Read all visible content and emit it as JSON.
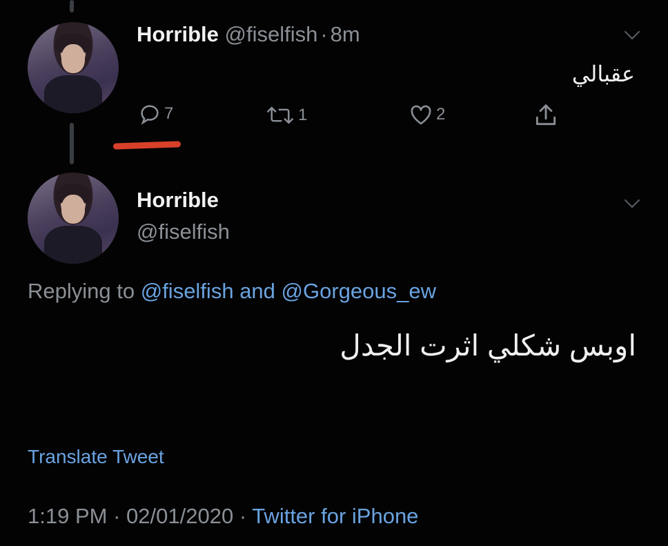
{
  "tweet1": {
    "name": "Horrible",
    "handle": "@fiselfish",
    "separator": "·",
    "time": "8m",
    "text": "عقبالي",
    "actions": {
      "reply_count": "7",
      "retweet_count": "1",
      "like_count": "2"
    }
  },
  "tweet2": {
    "name": "Horrible",
    "handle": "@fiselfish",
    "replying_prefix": "Replying to",
    "replying_user1": "@fiselfish",
    "replying_and": "and",
    "replying_user2": "@Gorgeous_ew",
    "text": "اوبس شكلي اثرت الجدل",
    "translate": "Translate Tweet",
    "time": "1:19 PM",
    "date": "02/01/2020",
    "dot": "·",
    "source": "Twitter for iPhone"
  },
  "icons": {
    "reply": "speech-bubble-icon",
    "retweet": "retweet-icon",
    "like": "heart-icon",
    "share": "share-icon",
    "menu": "chevron-down-icon"
  },
  "colors": {
    "background": "#030303",
    "link": "#6aa3e0",
    "muted": "#8b9096",
    "highlight": "#d8402a"
  }
}
